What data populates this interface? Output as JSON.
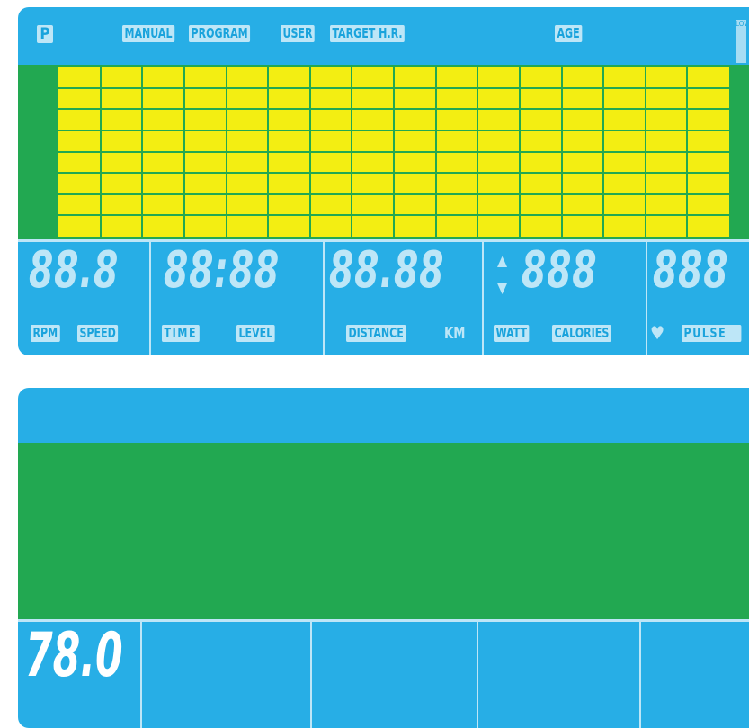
{
  "top_panel": {
    "p_icon": "P",
    "mode_labels": [
      "MANUAL",
      "PROGRAM",
      "USER",
      "TARGET H.R."
    ],
    "age_label": "AGE",
    "side_tag": "LOW",
    "digits": {
      "rpm_speed": "88.8",
      "time_level": "88:88",
      "distance": "88.88",
      "watt_calories": "888",
      "pulse": "888"
    },
    "bottom_labels": {
      "rpm": "RPM",
      "speed": "SPEED",
      "time": "TIME",
      "level": "LEVEL",
      "distance": "DISTANCE",
      "km": "KM",
      "watt": "WATT",
      "calories": "CALORIES",
      "pulse": "PULSE"
    },
    "matrix": {
      "columns": 16,
      "rows": 8
    }
  },
  "bottom_panel": {
    "readout": "78.0"
  },
  "colors": {
    "panel_blue": "#27aee6",
    "matrix_green": "#22a851",
    "matrix_yellow": "#f3ee12",
    "segment_light": "#bde6f7"
  },
  "icons": [
    "p-icon",
    "arrow-up-icon",
    "arrow-down-icon",
    "heart-icon"
  ]
}
